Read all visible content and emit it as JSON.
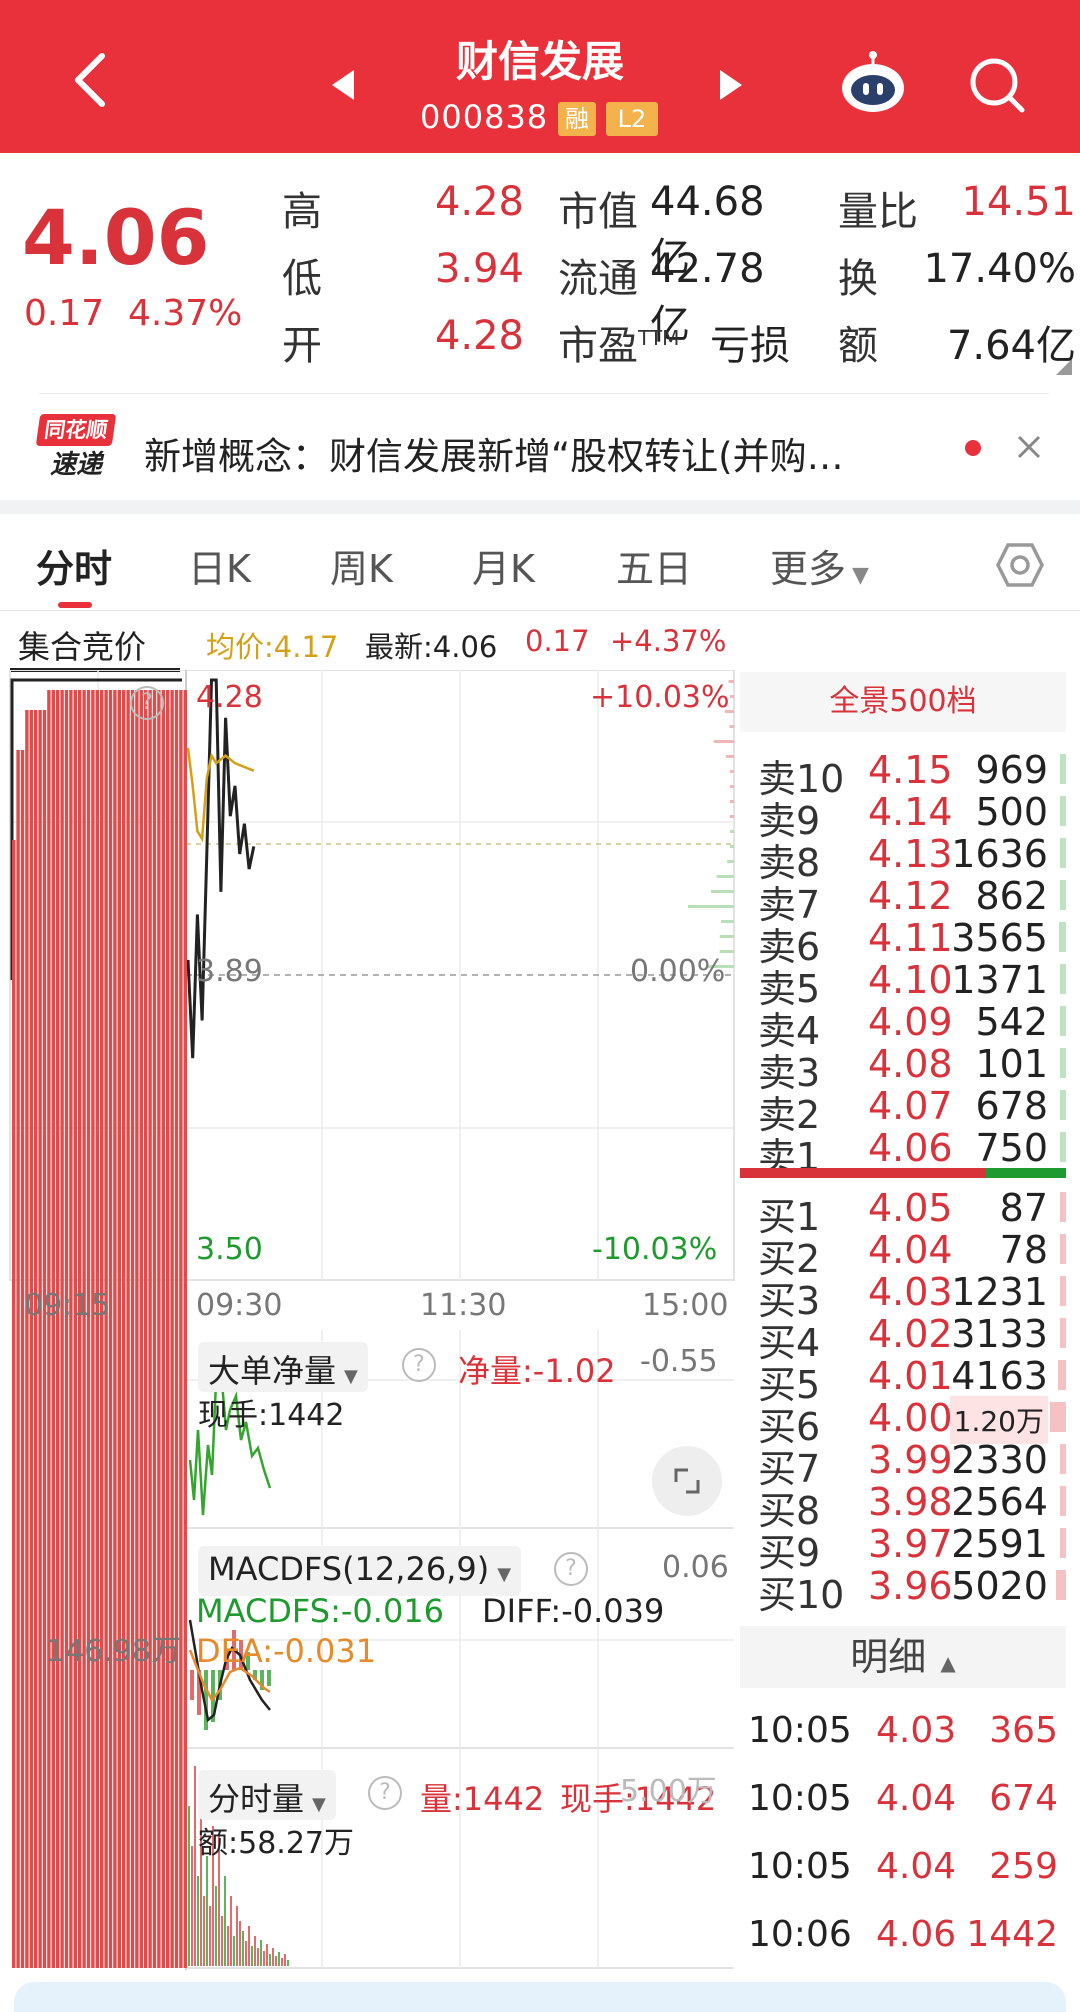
{
  "header": {
    "stock_name": "财信发展",
    "stock_code": "000838",
    "margin_badge": "融",
    "level_badge": "L2"
  },
  "quote": {
    "price": "4.06",
    "change": "0.17",
    "change_pct": "4.37%",
    "high_label": "高",
    "high_value": "4.28",
    "low_label": "低",
    "low_value": "3.94",
    "open_label": "开",
    "open_value": "4.28",
    "mktcap_label": "市值",
    "mktcap_value": "44.68亿",
    "float_label": "流通",
    "float_value": "42.78亿",
    "pe_label": "市盈",
    "pe_sup": "TTM",
    "pe_value": "亏损",
    "volratio_label": "量比",
    "volratio_value": "14.51",
    "turnover_label": "换",
    "turnover_value": "17.40%",
    "amount_label": "额",
    "amount_value": "7.64亿"
  },
  "news": {
    "logo_top": "同花顺",
    "logo_bottom": "速递",
    "text": "新增概念：财信发展新增“股权转让(并购…"
  },
  "tabs": [
    {
      "label": "分时"
    },
    {
      "label": "日K"
    },
    {
      "label": "周K"
    },
    {
      "label": "月K"
    },
    {
      "label": "五日"
    },
    {
      "label": "更多"
    }
  ],
  "infobar": {
    "auction_label": "集合竞价",
    "avg_price": "均价:4.17",
    "latest": "最新:4.06",
    "change": "0.17",
    "change_pct": "+4.37%"
  },
  "chart_data": {
    "type": "line",
    "price_high_label": "4.28",
    "price_ref_label": "3.89",
    "price_low_label": "3.50",
    "pct_high_label": "+10.03%",
    "pct_ref_label": "0.00%",
    "pct_low_label": "-10.03%",
    "time_labels": [
      "09:15",
      "09:30",
      "11:30",
      "15:00"
    ],
    "ylim": [
      3.5,
      4.28
    ],
    "auction_volume_label": "146.98万",
    "price_series": [
      {
        "t": "09:30",
        "v": 3.91
      },
      {
        "t": "09:31",
        "v": 3.78
      },
      {
        "t": "09:32",
        "v": 3.97
      },
      {
        "t": "09:33",
        "v": 3.83
      },
      {
        "t": "09:34",
        "v": 4.05
      },
      {
        "t": "09:35",
        "v": 4.28
      },
      {
        "t": "09:36",
        "v": 4.28
      },
      {
        "t": "09:37",
        "v": 4.0
      },
      {
        "t": "09:38",
        "v": 4.23
      },
      {
        "t": "09:39",
        "v": 4.1
      },
      {
        "t": "09:40",
        "v": 4.14
      },
      {
        "t": "09:41",
        "v": 4.05
      },
      {
        "t": "09:42",
        "v": 4.09
      },
      {
        "t": "09:43",
        "v": 4.03
      },
      {
        "t": "09:44",
        "v": 4.06
      }
    ],
    "avg_series": [
      {
        "t": "09:30",
        "v": 4.19
      },
      {
        "t": "09:31",
        "v": 4.14
      },
      {
        "t": "09:32",
        "v": 4.08
      },
      {
        "t": "09:33",
        "v": 4.07
      },
      {
        "t": "09:34",
        "v": 4.15
      },
      {
        "t": "09:35",
        "v": 4.18
      },
      {
        "t": "09:36",
        "v": 4.17
      },
      {
        "t": "09:38",
        "v": 4.18
      },
      {
        "t": "09:40",
        "v": 4.17
      },
      {
        "t": "09:44",
        "v": 4.16
      }
    ]
  },
  "indicators": {
    "big_order_label": "大单净量",
    "net_label": "净量:",
    "net_value": "-1.02",
    "net_axis": "-0.55",
    "current_hand": "现手:1442",
    "macd_label": "MACDFS(12,26,9)",
    "macd_axis": "0.06",
    "macdfs": "MACDFS:-0.016",
    "diff": "DIFF:-0.039",
    "dea": "DEA:-0.031",
    "vol_label": "分时量",
    "vol_value": "量:1442",
    "hand_value": "现手:1442",
    "vol_axis": "5.00万",
    "amount": "额:58.27万"
  },
  "orderbook": {
    "title": "全景500档",
    "asks": [
      {
        "label": "卖10",
        "price": "4.15",
        "vol": "969",
        "bar": 0.12
      },
      {
        "label": "卖9",
        "price": "4.14",
        "vol": "500",
        "bar": 0.06
      },
      {
        "label": "卖8",
        "price": "4.13",
        "vol": "1636",
        "bar": 0.2
      },
      {
        "label": "卖7",
        "price": "4.12",
        "vol": "862",
        "bar": 0.1
      },
      {
        "label": "卖6",
        "price": "4.11",
        "vol": "3565",
        "bar": 0.44
      },
      {
        "label": "卖5",
        "price": "4.10",
        "vol": "1371",
        "bar": 0.17
      },
      {
        "label": "卖4",
        "price": "4.09",
        "vol": "542",
        "bar": 0.07
      },
      {
        "label": "卖3",
        "price": "4.08",
        "vol": "101",
        "bar": 0.02
      },
      {
        "label": "卖2",
        "price": "4.07",
        "vol": "678",
        "bar": 0.08
      },
      {
        "label": "卖1",
        "price": "4.06",
        "vol": "750",
        "bar": 0.09
      }
    ],
    "bids": [
      {
        "label": "买1",
        "price": "4.05",
        "vol": "87",
        "bar": 0.01
      },
      {
        "label": "买2",
        "price": "4.04",
        "vol": "78",
        "bar": 0.01
      },
      {
        "label": "买3",
        "price": "4.03",
        "vol": "1231",
        "bar": 0.15
      },
      {
        "label": "买4",
        "price": "4.02",
        "vol": "3133",
        "bar": 0.38
      },
      {
        "label": "买5",
        "price": "4.01",
        "vol": "4163",
        "bar": 0.5
      },
      {
        "label": "买6",
        "price": "4.00",
        "vol": "1.20万",
        "bar": 1.0
      },
      {
        "label": "买7",
        "price": "3.99",
        "vol": "2330",
        "bar": 0.28
      },
      {
        "label": "买8",
        "price": "3.98",
        "vol": "2564",
        "bar": 0.31
      },
      {
        "label": "买9",
        "price": "3.97",
        "vol": "2591",
        "bar": 0.31
      },
      {
        "label": "买10",
        "price": "3.96",
        "vol": "5020",
        "bar": 0.6
      }
    ],
    "detail_label": "明细",
    "details": [
      {
        "time": "10:05",
        "price": "4.03",
        "vol": "365"
      },
      {
        "time": "10:05",
        "price": "4.04",
        "vol": "674"
      },
      {
        "time": "10:05",
        "price": "4.04",
        "vol": "259"
      },
      {
        "time": "10:06",
        "price": "4.06",
        "vol": "1442"
      }
    ]
  },
  "colors": {
    "brand_red": "#e8313b",
    "up": "#d8323b",
    "down": "#1f9a2e",
    "avg": "#d4a017"
  }
}
